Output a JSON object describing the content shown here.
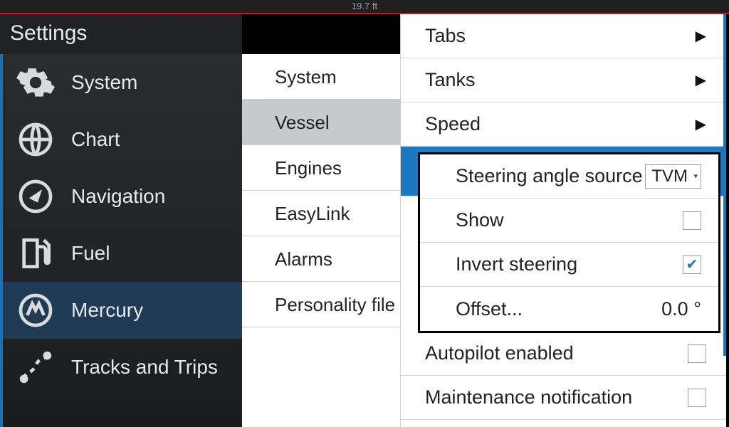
{
  "status": {
    "depth": "19.7 ft"
  },
  "title": "Settings",
  "sidebar": {
    "items": [
      {
        "label": "System"
      },
      {
        "label": "Chart"
      },
      {
        "label": "Navigation"
      },
      {
        "label": "Fuel"
      },
      {
        "label": "Mercury"
      },
      {
        "label": "Tracks and Trips"
      }
    ]
  },
  "midcol": {
    "items": [
      {
        "label": "System"
      },
      {
        "label": "Vessel"
      },
      {
        "label": "Engines"
      },
      {
        "label": "EasyLink"
      },
      {
        "label": "Alarms"
      },
      {
        "label": "Personality file"
      }
    ]
  },
  "right": {
    "tabs": {
      "label": "Tabs"
    },
    "tanks": {
      "label": "Tanks"
    },
    "speed": {
      "label": "Speed"
    },
    "autopilot": {
      "label": "Autopilot enabled",
      "checked": false
    },
    "maintenance": {
      "label": "Maintenance notification",
      "checked": false
    }
  },
  "steering_panel": {
    "source": {
      "label": "Steering angle source",
      "value": "TVM"
    },
    "show": {
      "label": "Show",
      "checked": false
    },
    "invert": {
      "label": "Invert steering",
      "checked": true
    },
    "offset": {
      "label": "Offset...",
      "value": "0.0 °"
    }
  }
}
